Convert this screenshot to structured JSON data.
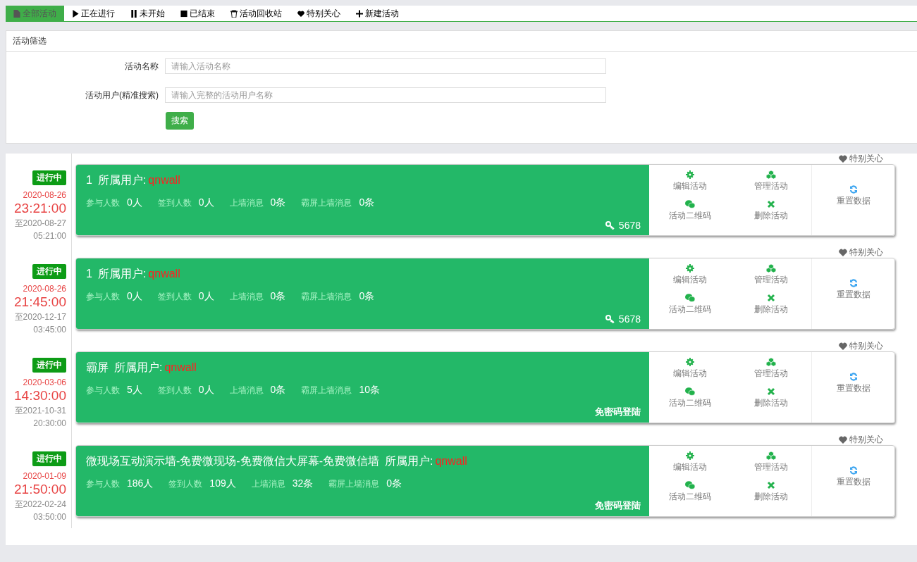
{
  "tabs": [
    {
      "kind": "file",
      "label": "全部活动",
      "selected": true
    },
    {
      "kind": "play",
      "label": "正在进行",
      "selected": false
    },
    {
      "kind": "pause",
      "label": "未开始",
      "selected": false
    },
    {
      "kind": "stop",
      "label": "已结束",
      "selected": false
    },
    {
      "kind": "trash",
      "label": "活动回收站",
      "selected": false
    },
    {
      "kind": "heart",
      "label": "特别关心",
      "selected": false
    },
    {
      "kind": "plus",
      "label": "新建活动",
      "selected": false
    }
  ],
  "filter": {
    "title": "活动筛选",
    "fields": [
      {
        "label": "活动名称",
        "placeholder": "请输入活动名称"
      },
      {
        "label": "活动用户(精准搜索)",
        "placeholder": "请输入完整的活动用户名称"
      }
    ],
    "button": "搜索"
  },
  "activities": [
    {
      "status": "进行中",
      "start_date": "2020-08-26",
      "start_time": "23:21:00",
      "end_date": "至2020-08-27",
      "end_time": "05:21:00",
      "favorite": "特别关心",
      "name": "1",
      "owner_label": "所属用户:",
      "owner": "qnwall",
      "stats": [
        {
          "label": "参与人数",
          "value": "0人"
        },
        {
          "label": "签到人数",
          "value": "0人"
        },
        {
          "label": "上墙消息",
          "value": "0条"
        },
        {
          "label": "霸屏上墙消息",
          "value": "0条"
        }
      ],
      "access": {
        "kind": "password",
        "text": "5678"
      },
      "actions": [
        {
          "kind": "gear",
          "label": "编辑活动"
        },
        {
          "kind": "cubes",
          "label": "管理活动"
        },
        {
          "kind": "chat",
          "label": "活动二维码"
        },
        {
          "kind": "cross",
          "label": "删除活动"
        }
      ],
      "reset": "重置数据"
    },
    {
      "status": "进行中",
      "start_date": "2020-08-26",
      "start_time": "21:45:00",
      "end_date": "至2020-12-17",
      "end_time": "03:45:00",
      "favorite": "特别关心",
      "name": "1",
      "owner_label": "所属用户:",
      "owner": "qnwall",
      "stats": [
        {
          "label": "参与人数",
          "value": "0人"
        },
        {
          "label": "签到人数",
          "value": "0人"
        },
        {
          "label": "上墙消息",
          "value": "0条"
        },
        {
          "label": "霸屏上墙消息",
          "value": "0条"
        }
      ],
      "access": {
        "kind": "password",
        "text": "5678"
      },
      "actions": [
        {
          "kind": "gear",
          "label": "编辑活动"
        },
        {
          "kind": "cubes",
          "label": "管理活动"
        },
        {
          "kind": "chat",
          "label": "活动二维码"
        },
        {
          "kind": "cross",
          "label": "删除活动"
        }
      ],
      "reset": "重置数据"
    },
    {
      "status": "进行中",
      "start_date": "2020-03-06",
      "start_time": "14:30:00",
      "end_date": "至2021-10-31",
      "end_time": "20:30:00",
      "favorite": "特别关心",
      "name": "霸屏",
      "owner_label": "所属用户:",
      "owner": "qnwall",
      "stats": [
        {
          "label": "参与人数",
          "value": "5人"
        },
        {
          "label": "签到人数",
          "value": "0人"
        },
        {
          "label": "上墙消息",
          "value": "0条"
        },
        {
          "label": "霸屏上墙消息",
          "value": "10条"
        }
      ],
      "access": {
        "kind": "free",
        "text": "免密码登陆"
      },
      "actions": [
        {
          "kind": "gear",
          "label": "编辑活动"
        },
        {
          "kind": "cubes",
          "label": "管理活动"
        },
        {
          "kind": "chat",
          "label": "活动二维码"
        },
        {
          "kind": "cross",
          "label": "删除活动"
        }
      ],
      "reset": "重置数据"
    },
    {
      "status": "进行中",
      "start_date": "2020-01-09",
      "start_time": "21:50:00",
      "end_date": "至2022-02-24",
      "end_time": "03:50:00",
      "favorite": "特别关心",
      "name": "微现场互动演示墙-免费微现场-免费微信大屏幕-免费微信墙",
      "owner_label": "所属用户:",
      "owner": "qnwall",
      "stats": [
        {
          "label": "参与人数",
          "value": "186人"
        },
        {
          "label": "签到人数",
          "value": "109人"
        },
        {
          "label": "上墙消息",
          "value": "32条"
        },
        {
          "label": "霸屏上墙消息",
          "value": "0条"
        }
      ],
      "access": {
        "kind": "free",
        "text": "免密码登陆"
      },
      "actions": [
        {
          "kind": "gear",
          "label": "编辑活动"
        },
        {
          "kind": "cubes",
          "label": "管理活动"
        },
        {
          "kind": "chat",
          "label": "活动二维码"
        },
        {
          "kind": "cross",
          "label": "删除活动"
        }
      ],
      "reset": "重置数据"
    }
  ]
}
